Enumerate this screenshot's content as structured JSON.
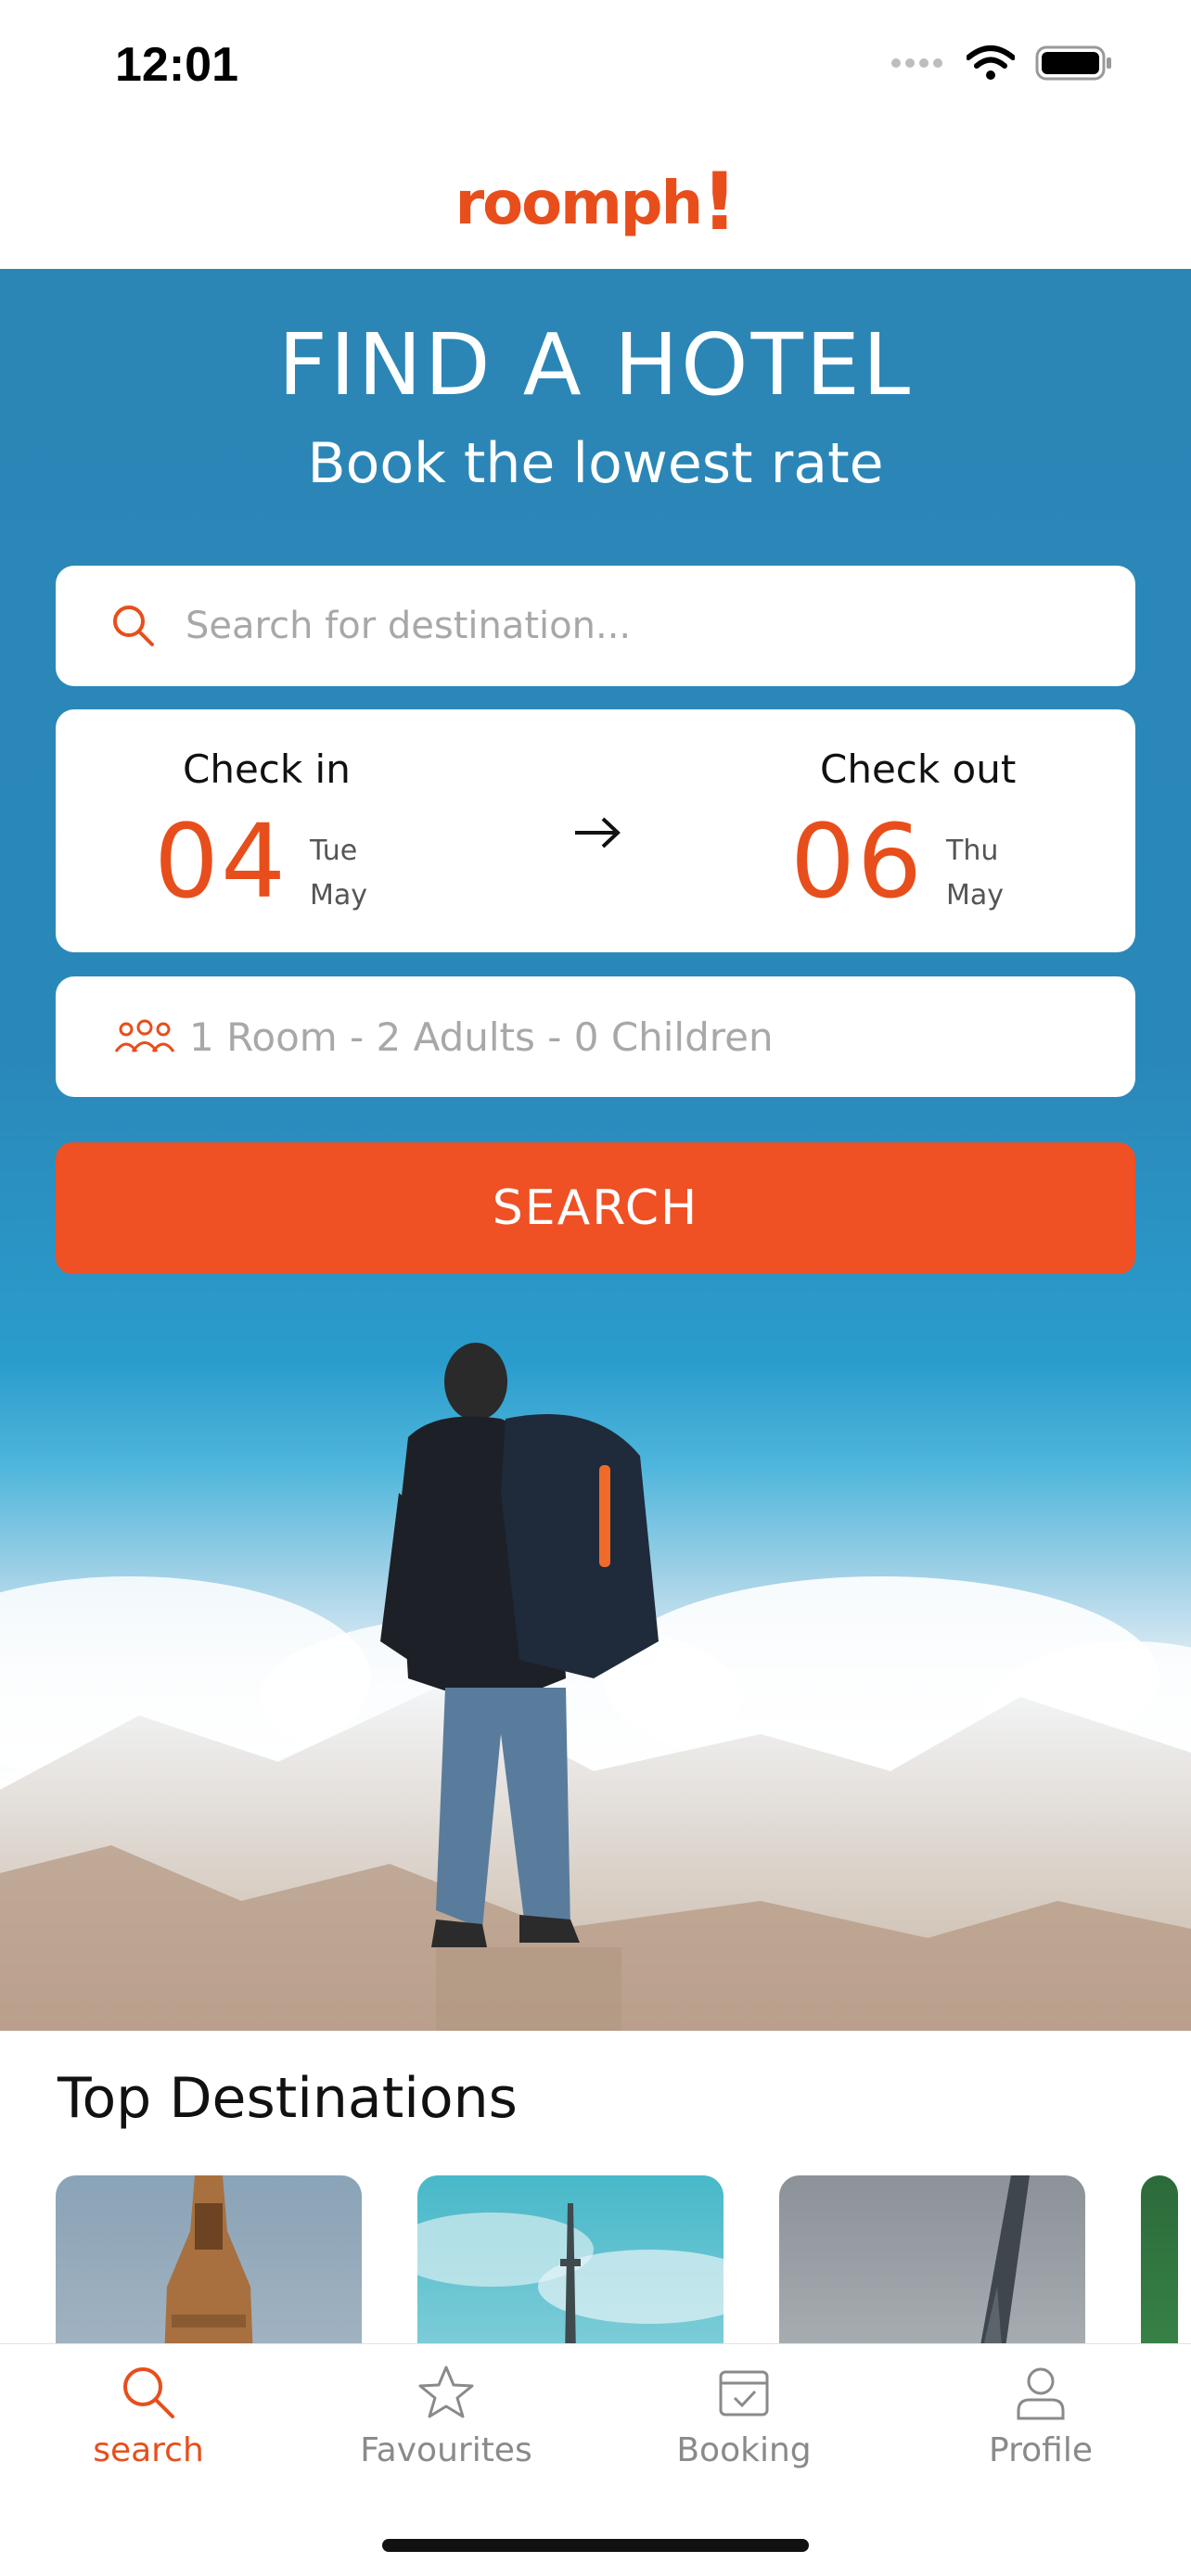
{
  "status_bar": {
    "time": "12:01",
    "icons": [
      "signal-icon",
      "wifi-icon",
      "battery-icon"
    ]
  },
  "header": {
    "logo_text": "roomph",
    "logo_mark": "!"
  },
  "hero": {
    "title": "FIND A HOTEL",
    "subtitle": "Book the lowest rate"
  },
  "search": {
    "placeholder": "Search for destination..."
  },
  "dates": {
    "check_in": {
      "label": "Check in",
      "day": "04",
      "weekday": "Tue",
      "month": "May"
    },
    "check_out": {
      "label": "Check out",
      "day": "06",
      "weekday": "Thu",
      "month": "May"
    }
  },
  "guests": {
    "text": "1 Room - 2 Adults - 0 Children"
  },
  "search_button": {
    "label": "SEARCH"
  },
  "top_destinations": {
    "title": "Top Destinations"
  },
  "tabbar": {
    "items": [
      {
        "label": "search",
        "icon": "search-icon",
        "active": true
      },
      {
        "label": "Favourites",
        "icon": "star-icon",
        "active": false
      },
      {
        "label": "Booking",
        "icon": "calendar-check-icon",
        "active": false
      },
      {
        "label": "Profile",
        "icon": "person-icon",
        "active": false
      }
    ]
  },
  "colors": {
    "accent": "#e84e1b",
    "button": "#ef5024",
    "hero_blue": "#2b86b6"
  }
}
